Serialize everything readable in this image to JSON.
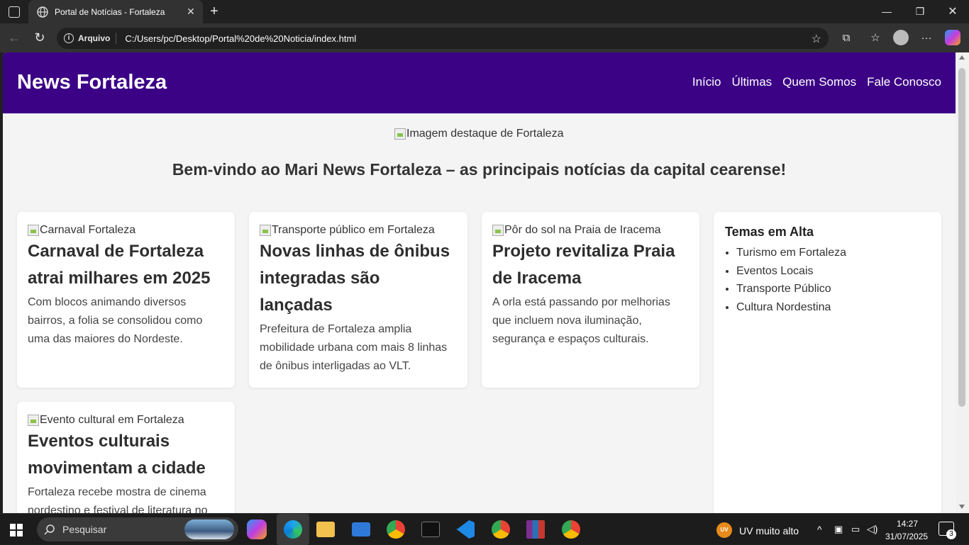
{
  "browser": {
    "tab_title": "Portal de Notícias - Fortaleza",
    "address_label": "Arquivo",
    "url": "C:/Users/pc/Desktop/Portal%20de%20Noticia/index.html"
  },
  "site": {
    "brand": "News Fortaleza",
    "nav": [
      "Início",
      "Últimas",
      "Quem Somos",
      "Fale Conosco"
    ],
    "hero_alt": "Imagem destaque de Fortaleza",
    "welcome": "Bem-vindo ao Mari News Fortaleza – as principais notícias da capital cearense!",
    "cards": [
      {
        "img_alt": "Carnaval Fortaleza",
        "title": "Carnaval de Fortaleza atrai milhares em 2025",
        "text": "Com blocos animando diversos bairros, a folia se consolidou como uma das maiores do Nordeste."
      },
      {
        "img_alt": "Transporte público em Fortaleza",
        "title": "Novas linhas de ônibus integradas são lançadas",
        "text": "Prefeitura de Fortaleza amplia mobilidade urbana com mais 8 linhas de ônibus interligadas ao VLT."
      },
      {
        "img_alt": "Pôr do sol na Praia de Iracema",
        "title": "Projeto revitaliza Praia de Iracema",
        "text": "A orla está passando por melhorias que incluem nova iluminação, segurança e espaços culturais."
      },
      {
        "img_alt": "Evento cultural em Fortaleza",
        "title": "Eventos culturais movimentam a cidade",
        "text": "Fortaleza recebe mostra de cinema nordestino e festival de literatura no"
      }
    ],
    "aside": {
      "title": "Temas em Alta",
      "items": [
        "Turismo em Fortaleza",
        "Eventos Locais",
        "Transporte Público",
        "Cultura Nordestina"
      ]
    }
  },
  "taskbar": {
    "search_placeholder": "Pesquisar",
    "weather": "UV muito alto",
    "weather_badge": "UV",
    "time": "14:27",
    "date": "31/07/2025",
    "notifications": "3"
  },
  "colors": {
    "header_bg": "#3b0286",
    "page_bg": "#f4f4f4"
  }
}
